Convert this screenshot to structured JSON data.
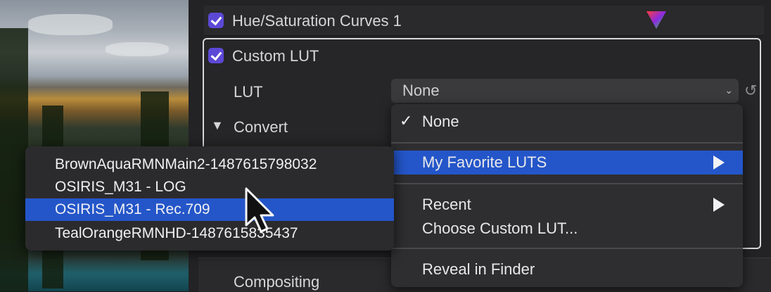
{
  "effects": {
    "hue_saturation": {
      "label": "Hue/Saturation Curves 1"
    },
    "custom_lut": {
      "label": "Custom LUT"
    },
    "lut_param": {
      "label": "LUT",
      "selected": "None"
    },
    "convert": {
      "label": "Convert"
    },
    "compositing": {
      "label": "Compositing"
    }
  },
  "lut_menu": {
    "items": [
      {
        "label": "None",
        "checked": true
      },
      {
        "label": "My Favorite LUTS",
        "submenu": true,
        "highlighted": true
      },
      {
        "label": "Recent",
        "submenu": true
      },
      {
        "label": "Choose Custom LUT..."
      },
      {
        "label": "Reveal in Finder"
      }
    ]
  },
  "favorites_submenu": {
    "items": [
      {
        "label": "BrownAquaRMNMain2-1487615798032"
      },
      {
        "label": "OSIRIS_M31 - LOG"
      },
      {
        "label": "OSIRIS_M31 - Rec.709",
        "highlighted": true
      },
      {
        "label": "TealOrangeRMNHD-1487615835437"
      }
    ]
  },
  "colors": {
    "checkbox": "#5b49d6",
    "highlight": "#2456c9"
  },
  "icons": [
    "color-triangle-icon",
    "reset-arrow-icon",
    "chevron-down-icon",
    "disclosure-triangle-icon",
    "submenu-arrow-icon",
    "pointer-cursor-icon"
  ]
}
